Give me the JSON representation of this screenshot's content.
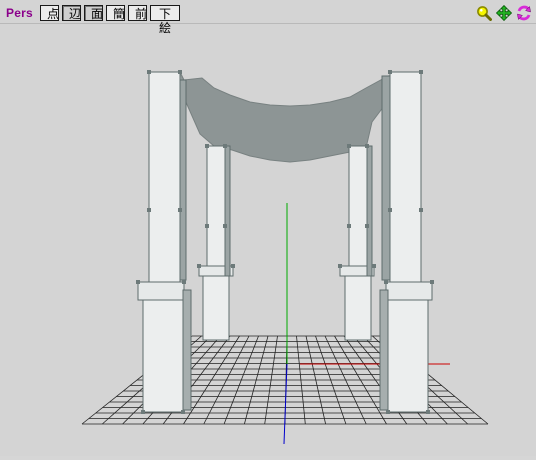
{
  "view": {
    "label": "Pers"
  },
  "modes": [
    {
      "label": "点"
    },
    {
      "label": "辺"
    },
    {
      "label": "面"
    },
    {
      "label": "簡"
    },
    {
      "label": "前"
    },
    {
      "label": "下絵"
    }
  ],
  "tools": [
    {
      "icon": "zoom-magnifier-icon",
      "color": "#c8c800"
    },
    {
      "icon": "move-arrows-icon",
      "color": "#18a018"
    },
    {
      "icon": "rotate-arrows-icon",
      "color": "#d020d0"
    }
  ],
  "scene": {
    "colors": {
      "background": "#d4d4d4",
      "grid": "#222222",
      "y_axis": "#00aa00",
      "z_axis": "#0000cc",
      "x_axis": "#cc0000",
      "pillar_fill": "#eceeee",
      "pillar_edge": "#5e6c6c",
      "canopy": "#8d9595",
      "vertex": "#6d7a7a"
    }
  }
}
